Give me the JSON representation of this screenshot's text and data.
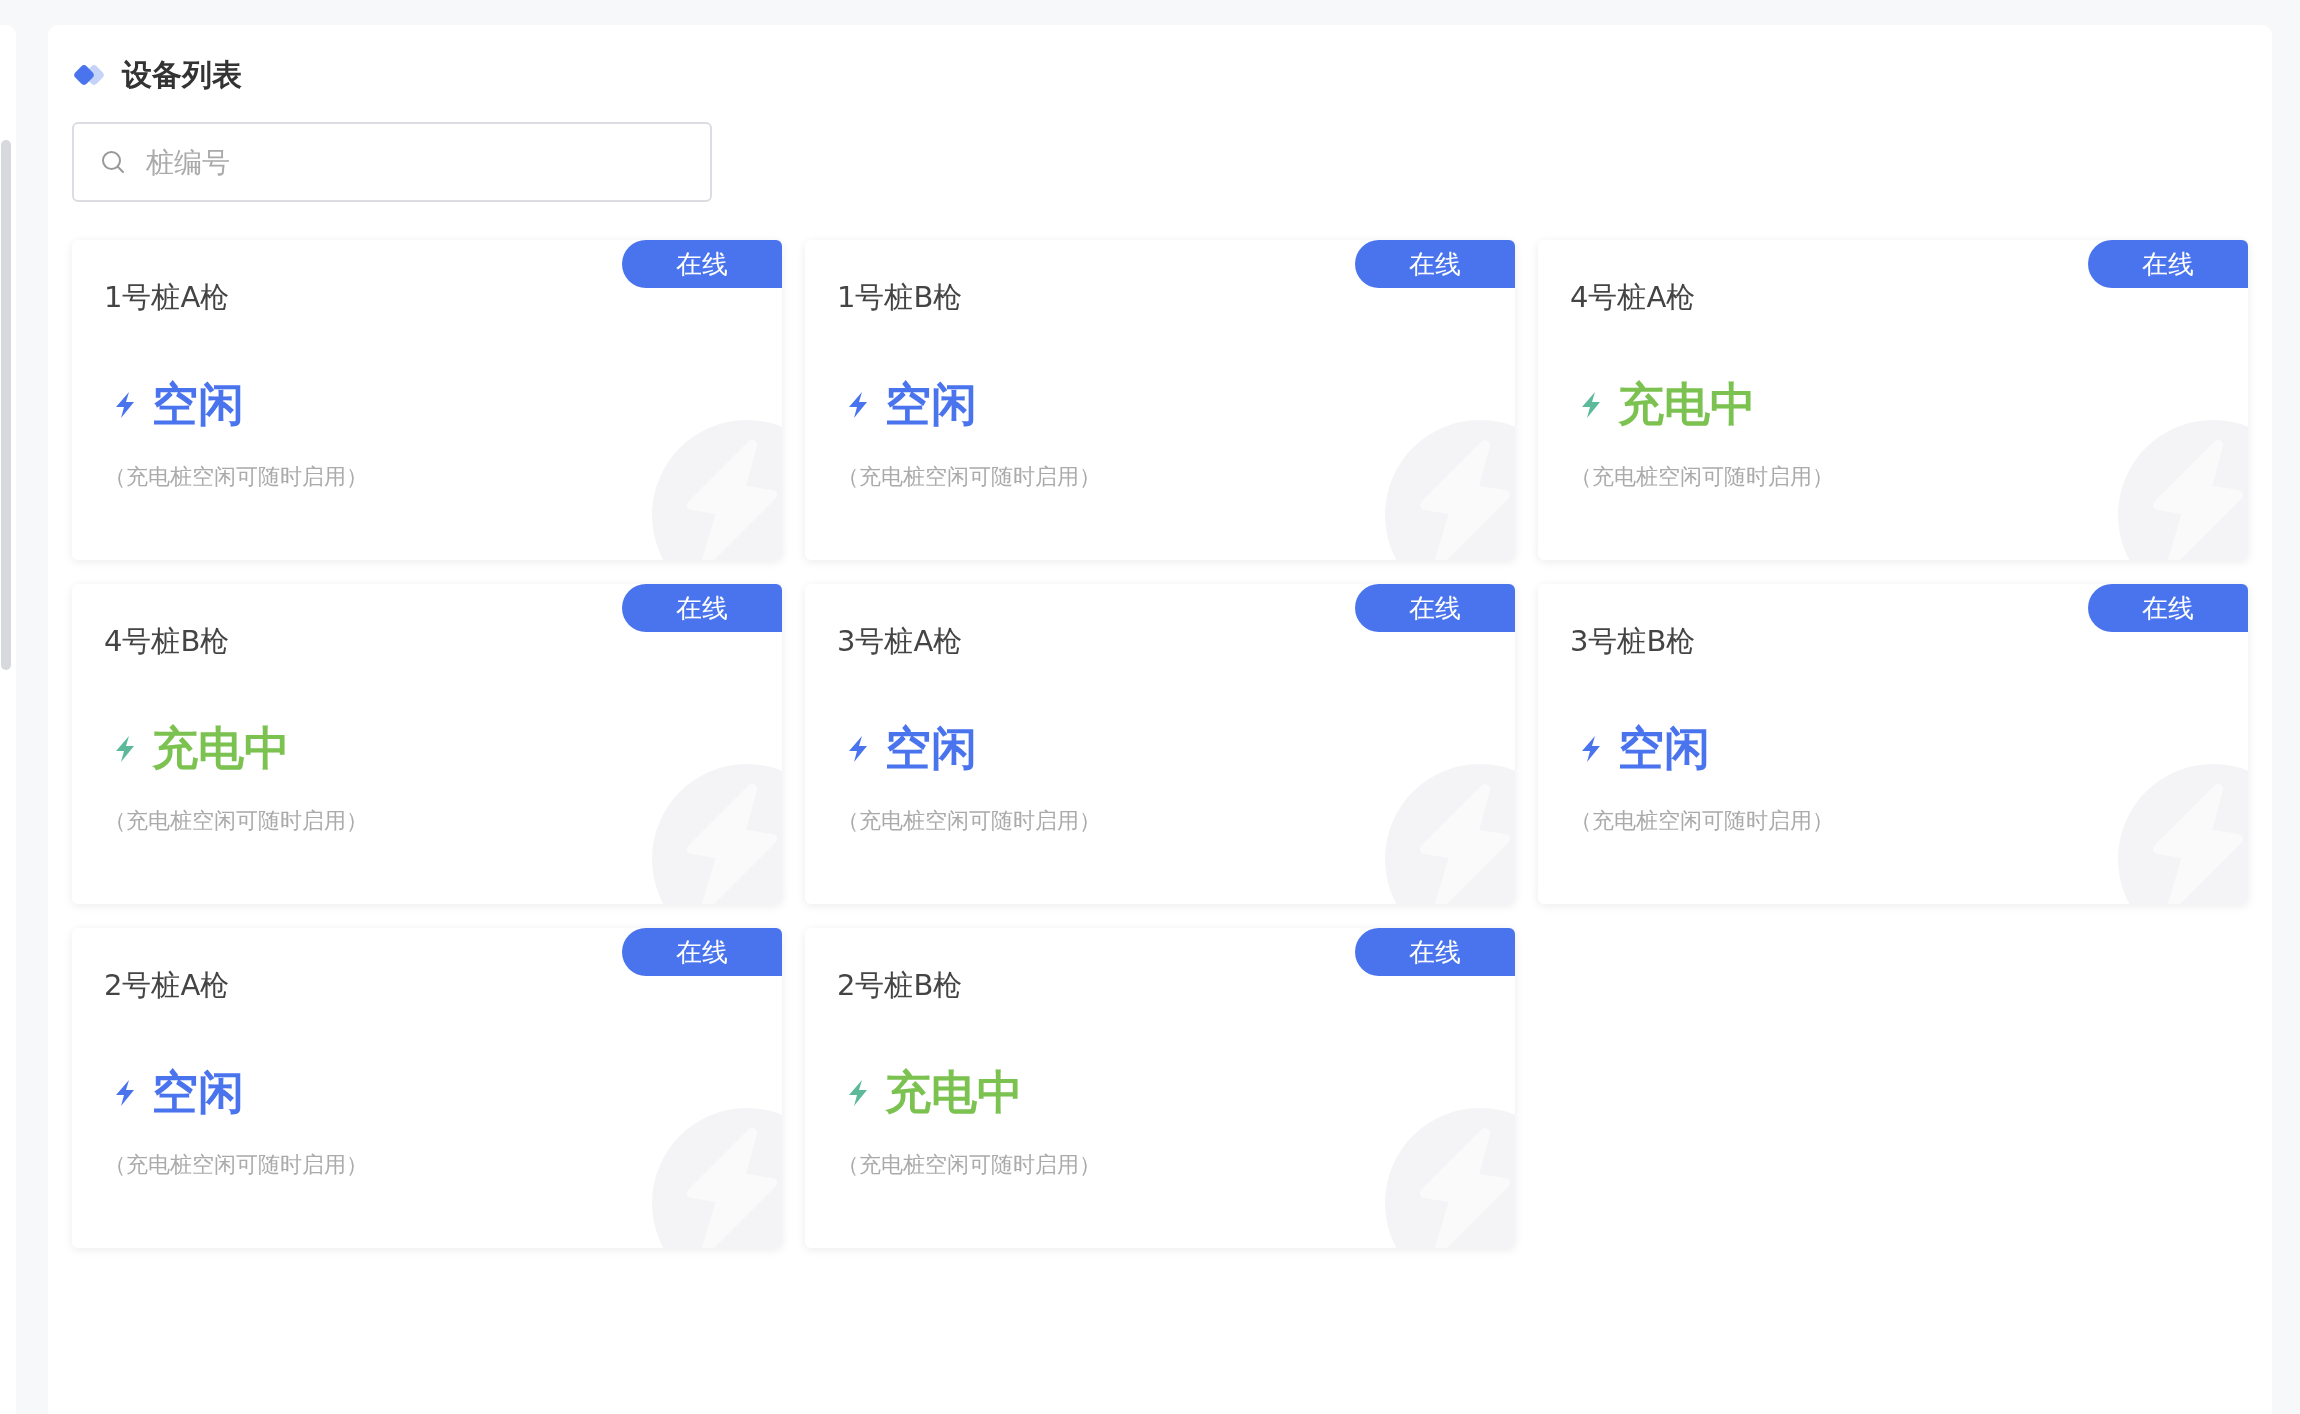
{
  "panel": {
    "title": "设备列表"
  },
  "search": {
    "placeholder": "桩编号"
  },
  "devices": [
    {
      "name": "1号桩A枪",
      "badge": "在线",
      "kind": "idle",
      "status": "空闲",
      "note": "（充电桩空闲可随时启用）"
    },
    {
      "name": "1号桩B枪",
      "badge": "在线",
      "kind": "idle",
      "status": "空闲",
      "note": "（充电桩空闲可随时启用）"
    },
    {
      "name": "4号桩A枪",
      "badge": "在线",
      "kind": "charging",
      "status": "充电中",
      "note": "（充电桩空闲可随时启用）"
    },
    {
      "name": "4号桩B枪",
      "badge": "在线",
      "kind": "charging",
      "status": "充电中",
      "note": "（充电桩空闲可随时启用）"
    },
    {
      "name": "3号桩A枪",
      "badge": "在线",
      "kind": "idle",
      "status": "空闲",
      "note": "（充电桩空闲可随时启用）"
    },
    {
      "name": "3号桩B枪",
      "badge": "在线",
      "kind": "idle",
      "status": "空闲",
      "note": "（充电桩空闲可随时启用）"
    },
    {
      "name": "2号桩A枪",
      "badge": "在线",
      "kind": "idle",
      "status": "空闲",
      "note": "（充电桩空闲可随时启用）"
    },
    {
      "name": "2号桩B枪",
      "badge": "在线",
      "kind": "charging",
      "status": "充电中",
      "note": "（充电桩空闲可随时启用）"
    }
  ]
}
